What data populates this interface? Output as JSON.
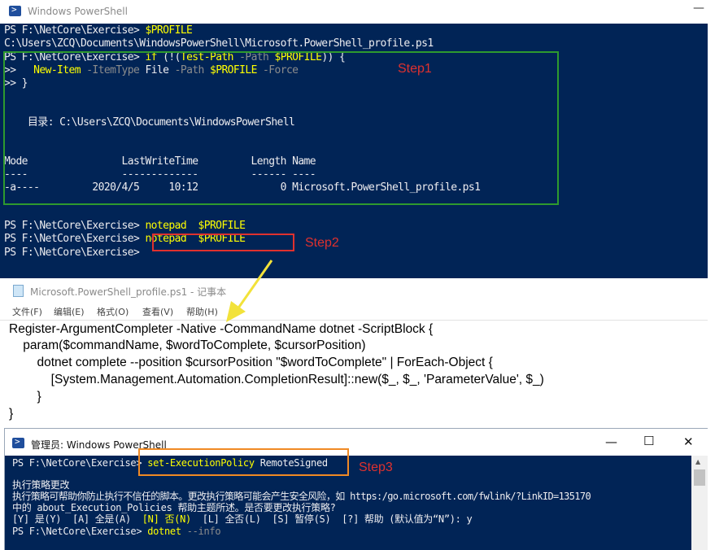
{
  "ps1": {
    "title": "Windows PowerShell",
    "minimize": "—",
    "lines": {
      "l1_prompt": "PS F:\\NetCore\\Exercise> ",
      "l1_cmd": "$PROFILE",
      "l2": "C:\\Users\\ZCQ\\Documents\\WindowsPowerShell\\Microsoft.PowerShell_profile.ps1",
      "l3_prompt": "PS F:\\NetCore\\Exercise> ",
      "l3_if": "if",
      "l3_paren": " (!(",
      "l3_testpath": "Test-Path",
      "l3_path": " -Path ",
      "l3_var": "$PROFILE",
      "l3_end": ")) {",
      "l4_prompt": ">>   ",
      "l4_cmd": "New-Item",
      "l4_itemtype": " -ItemType ",
      "l4_file": "File",
      "l4_path": " -Path ",
      "l4_var": "$PROFILE",
      "l4_force": " -Force",
      "l5": ">> }",
      "l6": "    目录: C:\\Users\\ZCQ\\Documents\\WindowsPowerShell",
      "l7": "Mode                LastWriteTime         Length Name",
      "l8": "----                -------------         ------ ----",
      "l9": "-a----         2020/4/5     10:12              0 Microsoft.PowerShell_profile.ps1",
      "l10_prompt": "PS F:\\NetCore\\Exercise> ",
      "l10_cmd": "notepad",
      "l10_var": "  $PROFILE",
      "l11_prompt": "PS F:\\NetCore\\Exercise> ",
      "l11_cmd": "notepad",
      "l11_var": "  $PROFILE",
      "l12": "PS F:\\NetCore\\Exercise>"
    },
    "step1": "Step1",
    "step2": "Step2"
  },
  "notepad": {
    "title": "Microsoft.PowerShell_profile.ps1 - 记事本",
    "menu": [
      "文件(F)",
      "编辑(E)",
      "格式(O)",
      "查看(V)",
      "帮助(H)"
    ],
    "lines": [
      "Register-ArgumentCompleter -Native -CommandName dotnet -ScriptBlock {",
      "    param($commandName, $wordToComplete, $cursorPosition)",
      "        dotnet complete --position $cursorPosition \"$wordToComplete\" | ForEach-Object {",
      "            [System.Management.Automation.CompletionResult]::new($_, $_, 'ParameterValue', $_)",
      "        }",
      "}"
    ]
  },
  "ps2": {
    "title": "管理员: Windows PowerShell",
    "controls": {
      "minimize": "—",
      "maximize": "☐",
      "close": "✕"
    },
    "lines": {
      "l1_prompt": "PS F:\\NetCore\\Exercise> ",
      "l1_cmd": "set-ExecutionPolicy",
      "l1_arg": " RemoteSigned",
      "l2": "执行策略更改",
      "l3": "执行策略可帮助你防止执行不信任的脚本。更改执行策略可能会产生安全风险，如 https:/go.microsoft.com/fwlink/?LinkID=135170",
      "l4": "中的 about_Execution_Policies 帮助主题所述。是否要更改执行策略?",
      "l5_a": "[Y] 是(Y)  [A] 全是(A)  ",
      "l5_n": "[N] 否(N)",
      "l5_b": "  [L] 全否(L)  [S] 暂停(S)  [?] 帮助 (默认值为“N”): y",
      "l6_prompt": "PS F:\\NetCore\\Exercise> ",
      "l6_cmd": "dotnet",
      "l6_arg": " --info"
    },
    "step3": "Step3"
  },
  "colors": {
    "ps_background": "#012456",
    "step_red": "#e0312e",
    "step1_box_green": "#2e9a2e",
    "step2_box_red": "#e0312e",
    "step3_box_orange": "#f08a24",
    "arrow_yellow": "#f2e23a"
  }
}
